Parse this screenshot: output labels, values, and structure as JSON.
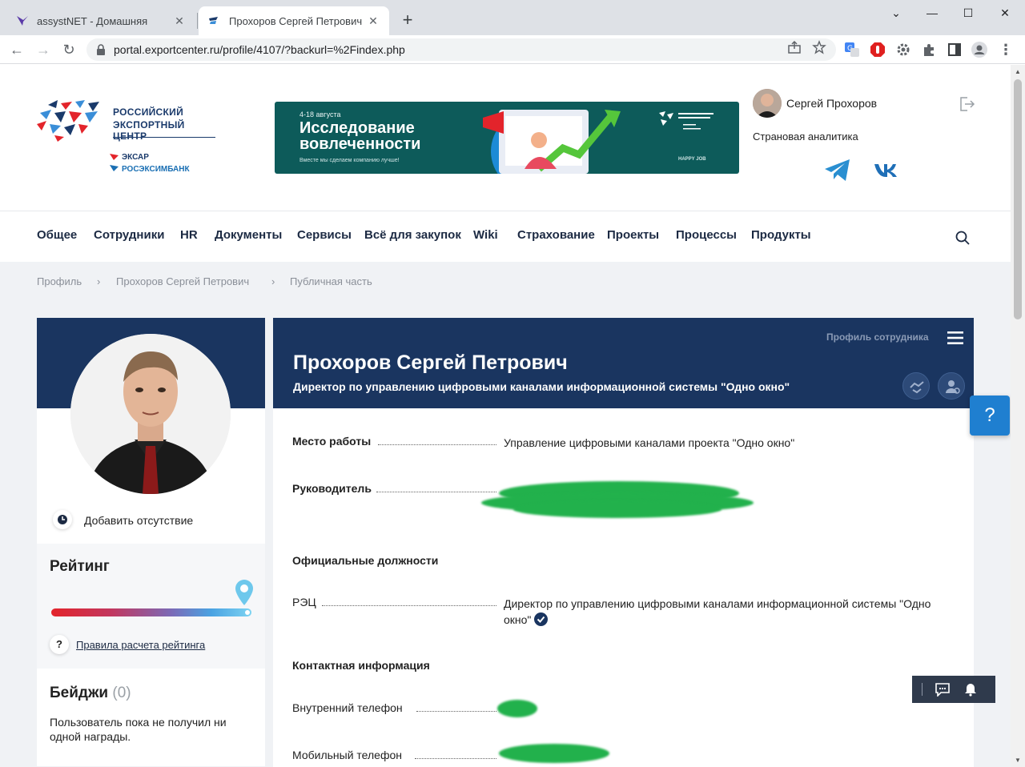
{
  "browser": {
    "tabs": [
      {
        "title": "assystNET - Домашняя",
        "active": false
      },
      {
        "title": "Прохоров Сергей Петрович",
        "active": true
      }
    ],
    "url": "portal.exportcenter.ru/profile/4107/?backurl=%2Findex.php"
  },
  "header": {
    "logo_line1": "РОССИЙСКИЙ",
    "logo_line2": "ЭКСПОРТНЫЙ ЦЕНТР",
    "logo_sub1": "ЭКСАР",
    "logo_sub2": "РОСЭКСИМБАНК",
    "banner": {
      "date": "4-18 августа",
      "title_line1": "Исследование",
      "title_line2": "вовлеченности",
      "subtitle": "Вместе мы сделаем компанию лучше!",
      "platform": "HAPPY JOB"
    },
    "user_name": "Сергей Прохоров",
    "user_dept": "Страновая аналитика"
  },
  "nav": {
    "items": [
      "Общее",
      "Сотрудники",
      "HR",
      "Документы",
      "Сервисы",
      "Всё для закупок",
      "Wiki",
      "Страхование",
      "Проекты",
      "Процессы",
      "Продукты"
    ]
  },
  "breadcrumbs": [
    "Профиль",
    "Прохоров Сергей Петрович",
    "Публичная часть"
  ],
  "left": {
    "absence": "Добавить отсутствие",
    "rating_title": "Рейтинг",
    "rating_level": 0.97,
    "rating_rules": "Правила расчета рейтинга",
    "badges_title": "Бейджи",
    "badges_count": "(0)",
    "badges_text": "Пользователь пока не получил ни одной награды."
  },
  "profile": {
    "label": "Профиль сотрудника",
    "name": "Прохоров Сергей Петрович",
    "position": "Директор по управлению цифровыми каналами информационной системы \"Одно окно\"",
    "workplace_label": "Место работы",
    "workplace": "Управление цифровыми каналами проекта \"Одно окно\"",
    "manager_label": "Руководитель",
    "official_title": "Официальные должности",
    "org_label": "РЭЦ",
    "org_position": "Директор по управлению цифровыми каналами информационной системы \"Одно окно\"",
    "contacts_title": "Контактная информация",
    "phone_internal_label": "Внутренний телефон",
    "phone_mobile_label": "Мобильный телефон"
  },
  "help_label": "?"
}
